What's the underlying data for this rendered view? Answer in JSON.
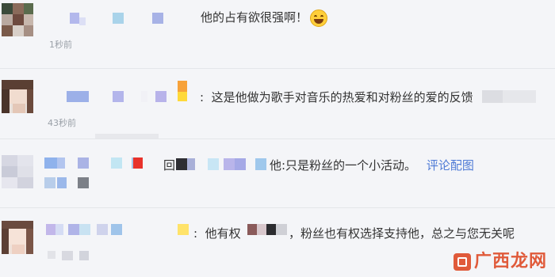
{
  "comments": [
    {
      "text": "他的占有欲很强啊！",
      "time": "1秒前",
      "emoji": "laughing-emoji"
    },
    {
      "text": "这是他做为歌手对音乐的热爱和对粉丝的爱的反馈",
      "time": "43秒前"
    },
    {
      "reply_prefix": "回",
      "text_tail": "他:只是粉丝的一个小活动。",
      "link": "评论配图"
    },
    {
      "text_start": "他有权",
      "text_end": "，粉丝也有权选择支持他，总之与您无关呢"
    }
  ],
  "watermark": {
    "text": "广西龙网"
  },
  "colors": {
    "link": "#4f7bd6",
    "watermark": "#e05a3a",
    "background": "#f4f5f8"
  }
}
